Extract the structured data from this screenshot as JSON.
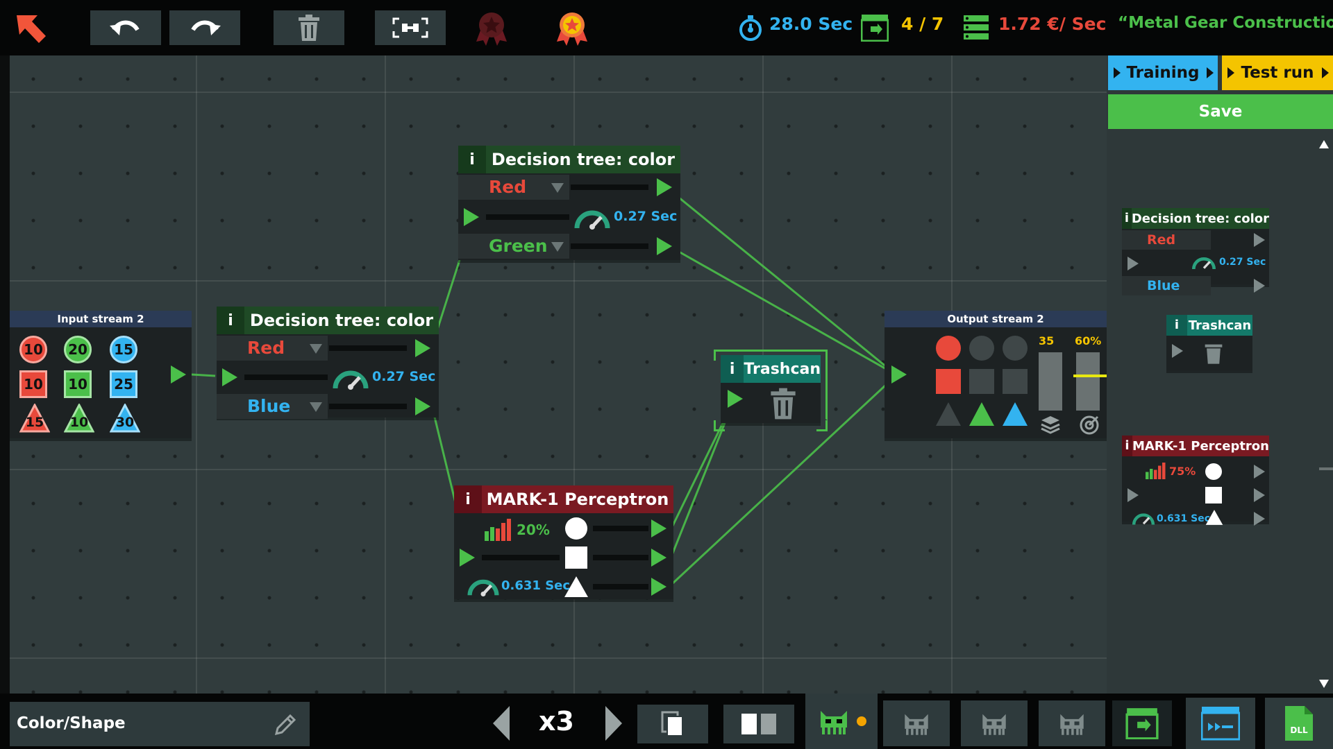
{
  "top": {
    "timer": "28.0 Sec",
    "progress": "4 / 7",
    "cost": "1.72 €/ Sec",
    "level_title": "“Metal Gear Construction”",
    "icons": [
      "back-arrow-icon",
      "undo-icon",
      "redo-icon",
      "trash-icon",
      "fit-view-icon",
      "medal-bronze-icon",
      "medal-gold-icon",
      "stopwatch-icon",
      "monitor-icon",
      "server-icon"
    ]
  },
  "sidebar": {
    "training_label": "Training",
    "testrun_label": "Test run",
    "save_label": "Save",
    "dt_title": "Decision tree: color",
    "dt_out1": "Red",
    "dt_out2": "Blue",
    "dt_time": "0.27 Sec",
    "trash_title": "Trashcan",
    "perc_title": "MARK-1 Perceptron",
    "perc_pct": "75%",
    "perc_time": "0.631 Sec"
  },
  "nodes": {
    "input": {
      "title": "Input stream 2",
      "circles": [
        "10",
        "20",
        "15"
      ],
      "squares": [
        "10",
        "10",
        "25"
      ],
      "triangles": [
        "15",
        "10",
        "30"
      ]
    },
    "dt1": {
      "info": "i",
      "title": "Decision tree: color",
      "out1": "Red",
      "out2": "Blue",
      "time": "0.27 Sec"
    },
    "dt2": {
      "info": "i",
      "title": "Decision tree: color",
      "out1": "Red",
      "out2": "Green",
      "time": "0.27 Sec"
    },
    "trash": {
      "info": "i",
      "title": "Trashcan"
    },
    "perc": {
      "info": "i",
      "title": "MARK-1 Perceptron",
      "pct": "20%",
      "time": "0.631 Sec"
    },
    "output": {
      "title": "Output stream 2",
      "count": "35",
      "accuracy": "60%",
      "accuracy_fraction": 0.6
    }
  },
  "colors": {
    "red": "#e8493b",
    "green": "#4bbf4a",
    "blue": "#33b3f0",
    "yellow": "#f4c400",
    "dark_red": "#7a1a22",
    "dark_green": "#1f4a26",
    "teal": "#147a6a"
  },
  "bottom": {
    "dataset_name": "Color/Shape",
    "speed": "x3",
    "dll_label": "DLL"
  }
}
